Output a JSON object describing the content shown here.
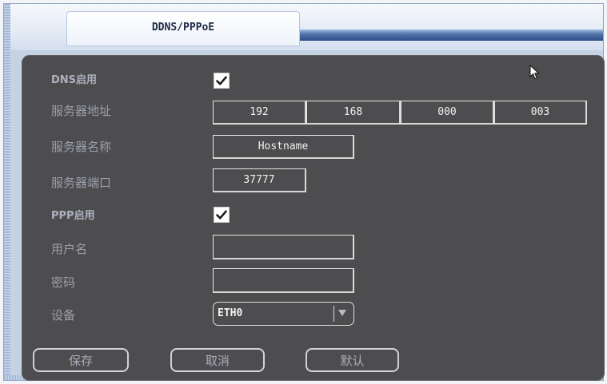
{
  "window": {
    "tab_title": "DDNS/PPPoE"
  },
  "form": {
    "dns_enable": {
      "label": "DNS启用",
      "checked": true
    },
    "server_address": {
      "label": "服务器地址",
      "octets": [
        "192",
        "168",
        "000",
        "003"
      ]
    },
    "server_name": {
      "label": "服务器名称",
      "value": "Hostname"
    },
    "server_port": {
      "label": "服务器端口",
      "value": "37777"
    },
    "ppp_enable": {
      "label": "PPP启用",
      "checked": true
    },
    "username": {
      "label": "用户名",
      "value": ""
    },
    "password": {
      "label": "密码",
      "value": ""
    },
    "device": {
      "label": "设备",
      "value": "ETH0"
    }
  },
  "buttons": {
    "save": "保存",
    "cancel": "取消",
    "default": "默认"
  },
  "icons": {
    "checkbox": "check-icon",
    "dropdown": "chevron-down-icon",
    "cursor": "mouse-pointer-icon"
  }
}
